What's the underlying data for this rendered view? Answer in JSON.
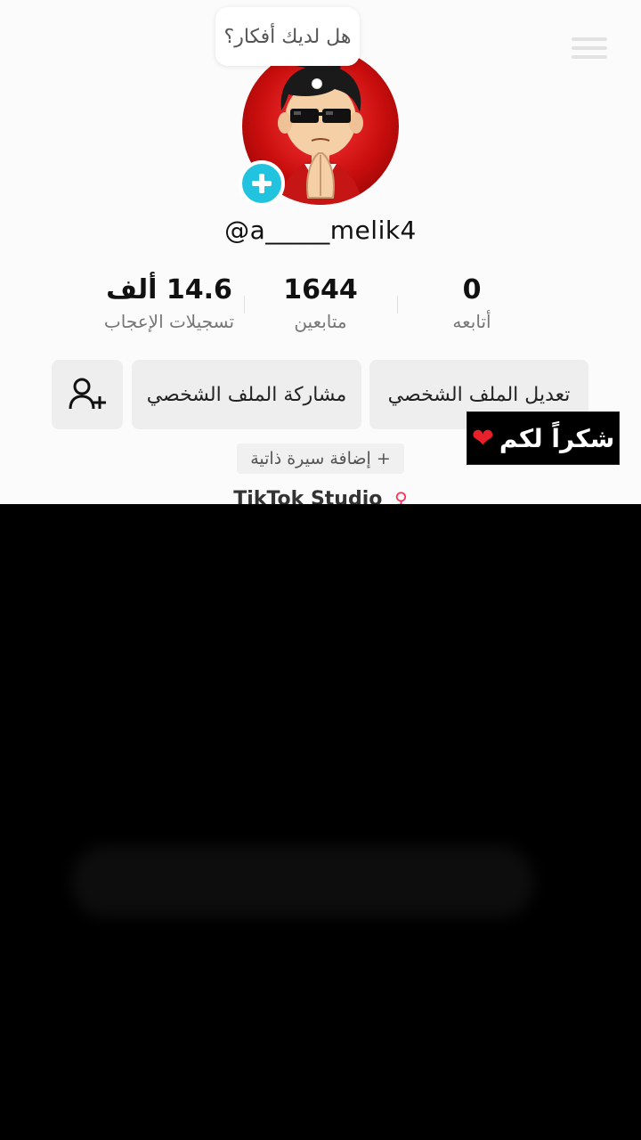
{
  "tooltip": {
    "text": "هل لديك أفكار؟"
  },
  "profile": {
    "username": "@a_____melik4"
  },
  "stats": [
    {
      "value": "0",
      "label": "أتابعه"
    },
    {
      "value": "1644",
      "label": "متابعين"
    },
    {
      "value": "14.6 ألف",
      "label": "تسجيلات الإعجاب"
    }
  ],
  "buttons": {
    "edit_profile": "تعديل الملف الشخصي",
    "share_profile": "مشاركة الملف الشخصي"
  },
  "bio": {
    "add_label": "+ إضافة سيرة ذاتية"
  },
  "studio": {
    "label": "TikTok Studio"
  },
  "overlay": {
    "caption": "شكراً لكم"
  },
  "colors": {
    "accent_blue": "#22c3df",
    "avatar_red": "#d11414",
    "heart_red": "#e8202a"
  },
  "icons": {
    "add_friend": "person-add-icon",
    "heart": "heart-icon",
    "studio": "studio-icon"
  }
}
